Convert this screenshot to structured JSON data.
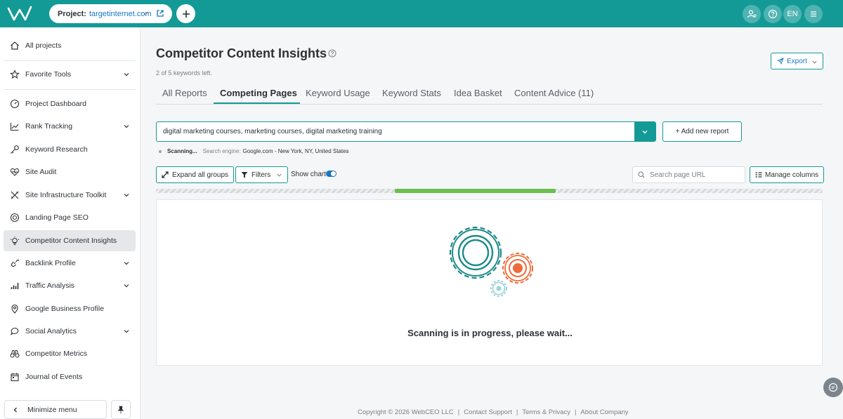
{
  "header": {
    "project_label": "Project:",
    "project_value": "targetinternet.com",
    "language": "EN"
  },
  "sidebar": {
    "items": [
      {
        "label": "All projects",
        "icon": "home-icon"
      },
      {
        "label": "Favorite Tools",
        "icon": "star-icon"
      },
      {
        "label": "Project Dashboard",
        "icon": "dashboard-icon"
      },
      {
        "label": "Rank Tracking",
        "icon": "line-chart-icon"
      },
      {
        "label": "Keyword Research",
        "icon": "key-icon"
      },
      {
        "label": "Site Audit",
        "icon": "heart-pulse-icon"
      },
      {
        "label": "Site Infrastructure Toolkit",
        "icon": "tools-icon"
      },
      {
        "label": "Landing Page SEO",
        "icon": "target-icon"
      },
      {
        "label": "Competitor Content Insights",
        "icon": "lightbulb-icon"
      },
      {
        "label": "Backlink Profile",
        "icon": "link-icon"
      },
      {
        "label": "Traffic Analysis",
        "icon": "bar-chart-icon"
      },
      {
        "label": "Google Business Profile",
        "icon": "map-pin-icon"
      },
      {
        "label": "Social Analytics",
        "icon": "chat-icon"
      },
      {
        "label": "Competitor Metrics",
        "icon": "binoculars-icon"
      },
      {
        "label": "Journal of Events",
        "icon": "calendar-icon"
      }
    ],
    "active_item": "Competitor Content Insights",
    "minimize_label": "Minimize menu"
  },
  "main": {
    "title": "Competitor Content Insights",
    "keywords_left": "2 of 5 keywords left.",
    "export_label": "Export",
    "tabs": [
      {
        "label": "All Reports"
      },
      {
        "label": "Competing Pages"
      },
      {
        "label": "Keyword Usage"
      },
      {
        "label": "Keyword Stats"
      },
      {
        "label": "Idea Basket"
      },
      {
        "label": "Content Advice (11)"
      }
    ],
    "active_tab": "Competing Pages",
    "keyword_input": "digital marketing courses, marketing courses, digital marketing training",
    "add_report_label": "+ Add new report",
    "scan_status": "Scanning...",
    "search_engine_label": "Search engine:",
    "search_engine_value": "Google.com - New York, NY, United States",
    "expand_label": "Expand all groups",
    "filters_label": "Filters",
    "show_chart_label": "Show chart",
    "search_url_placeholder": "Search page URL",
    "manage_columns_label": "Manage columns",
    "progress": {
      "start": 0.358,
      "end": 0.6
    },
    "scanning_message": "Scanning is in progress, please wait..."
  },
  "footer": {
    "copyright": "Copyright © 2026 WebCEO LLC",
    "links": [
      "Contact Support",
      "Terms & Privacy",
      "About Company"
    ]
  },
  "colors": {
    "brand_teal": "#139a97",
    "link_blue": "#1976c4",
    "progress_green": "#6cbf4e",
    "gear_orange": "#ef6a3b"
  }
}
